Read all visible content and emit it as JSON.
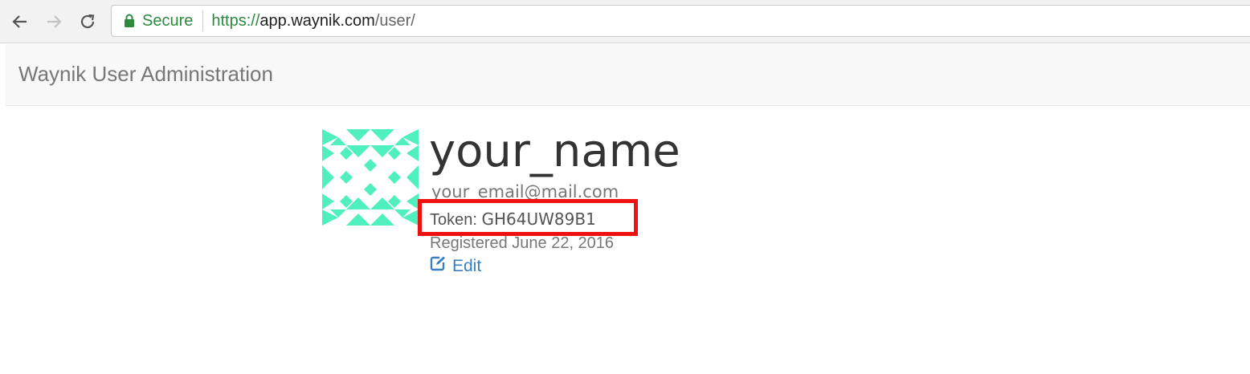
{
  "browser": {
    "secure_label": "Secure",
    "url_scheme": "https://",
    "url_host": "app.waynik.com",
    "url_path": "/user/"
  },
  "navbar": {
    "brand": "Waynik User Administration"
  },
  "profile": {
    "username": "your_name",
    "email": "your_email@mail.com",
    "token_label": "Token:",
    "token_value": "GH64UW89B1",
    "registered": "Registered June 22, 2016",
    "edit_label": "Edit"
  },
  "colors": {
    "avatar": "#4ff0bd",
    "link": "#3a7fc1",
    "secure": "#2b8a3e",
    "highlight": "#ee1111"
  },
  "icons": [
    "back-arrow-icon",
    "forward-arrow-icon",
    "reload-icon",
    "lock-icon",
    "edit-icon"
  ]
}
